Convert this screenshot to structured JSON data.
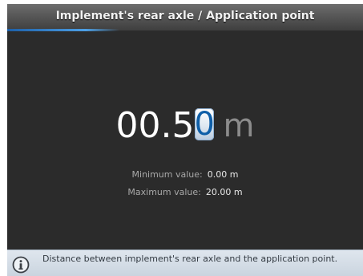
{
  "header": {
    "title": "Implement's rear axle / Application point"
  },
  "editor": {
    "value_prefix": "00.5",
    "cursor_digit": "0",
    "unit": "m"
  },
  "limits": {
    "min_label": "Minimum value:",
    "min_value": "0.00 m",
    "max_label": "Maximum value:",
    "max_value": "20.00 m"
  },
  "help": {
    "icon": "info-icon",
    "text": "Distance between implement's rear axle and the application point."
  }
}
